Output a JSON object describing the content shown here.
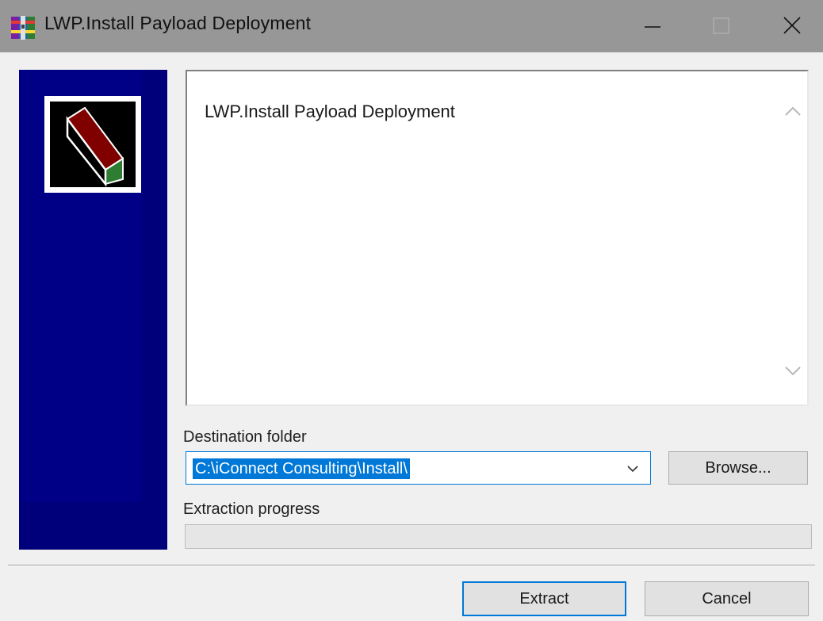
{
  "window": {
    "title": "LWP.Install Payload Deployment",
    "icon": "winrar-archive-icon",
    "controls": [
      "minimize-icon",
      "maximize-icon",
      "close-icon"
    ]
  },
  "sidebar": {
    "logo": "archive-box-icon",
    "background_color": "#00007a"
  },
  "description": {
    "text": "LWP.Install Payload Deployment"
  },
  "destination": {
    "label": "Destination folder",
    "value": "C:\\iConnect Consulting\\Install\\",
    "browse_label": "Browse..."
  },
  "progress": {
    "label": "Extraction progress",
    "value": 0
  },
  "footer": {
    "extract_label": "Extract",
    "cancel_label": "Cancel"
  },
  "colors": {
    "accent": "#0078d7",
    "titlebar": "#979797"
  }
}
